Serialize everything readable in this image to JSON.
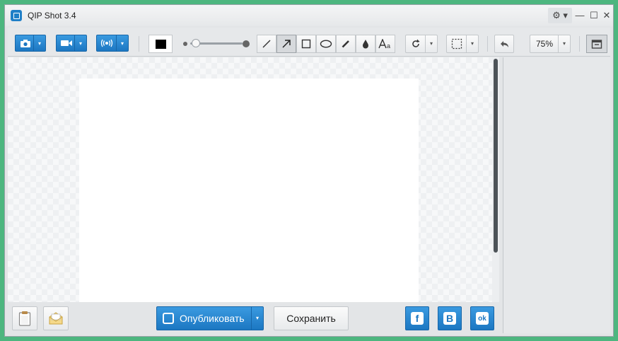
{
  "window": {
    "title": "QIP Shot 3.4"
  },
  "titlebar": {
    "settings_glyph": "⚙ ▾",
    "min_glyph": "—",
    "max_glyph": "☐",
    "close_glyph": "✕"
  },
  "toolbar": {
    "dropdown_glyph": "▾",
    "color": "#000000",
    "zoom": "75%"
  },
  "bottom": {
    "publish_label": "Опубликовать",
    "save_label": "Сохранить",
    "facebook_glyph": "f",
    "vk_glyph": "B",
    "ok_glyph": "ok"
  },
  "colors": {
    "accent": "#1f7fc7",
    "frame": "#4db67f"
  }
}
